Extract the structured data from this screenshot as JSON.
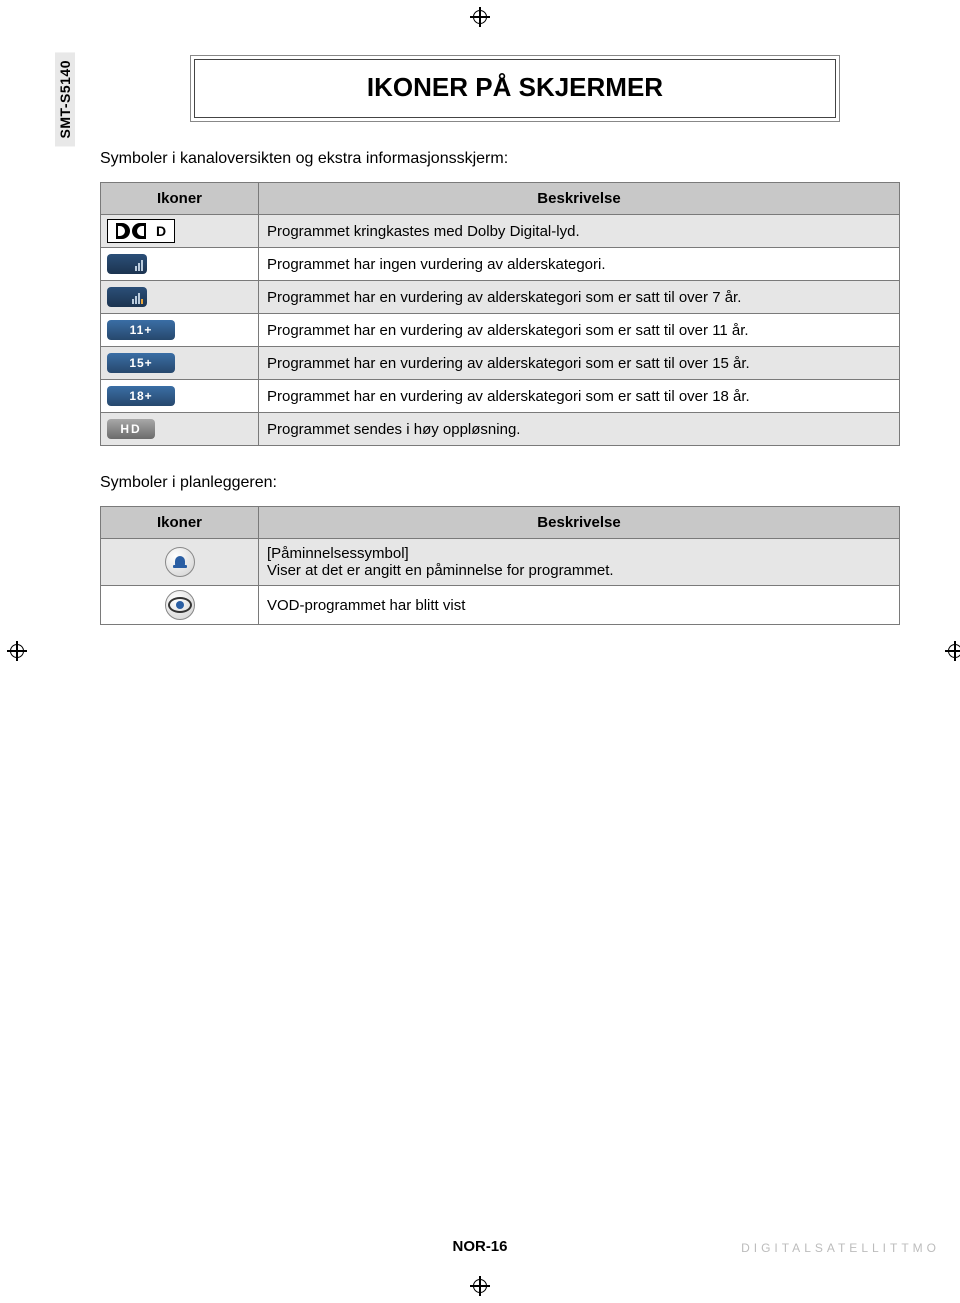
{
  "side_tab": "SMT-S5140",
  "title": "IKONER PÅ SKJERMER",
  "intro1": "Symboler i kanaloversikten og ekstra informasjonsskjerm:",
  "intro2": "Symboler i planleggeren:",
  "table1": {
    "h1": "Ikoner",
    "h2": "Beskrivelse",
    "rows": [
      {
        "icon": "dolby",
        "desc": "Programmet kringkastes med Dolby Digital-lyd."
      },
      {
        "icon": "norating",
        "desc": "Programmet har ingen vurdering av alderskategori."
      },
      {
        "icon": "age7",
        "desc": "Programmet har en vurdering av alderskategori som er satt til over 7 år."
      },
      {
        "icon": "11+",
        "label": "11+",
        "desc": "Programmet har en vurdering av alderskategori som er satt til over 11 år."
      },
      {
        "icon": "15+",
        "label": "15+",
        "desc": "Programmet har en vurdering av alderskategori som er satt til over 15 år."
      },
      {
        "icon": "18+",
        "label": "18+",
        "desc": "Programmet har en vurdering av alderskategori som er satt til over 18 år."
      },
      {
        "icon": "HD",
        "label": "HD",
        "desc": "Programmet sendes i høy oppløsning."
      }
    ]
  },
  "table2": {
    "h1": "Ikoner",
    "h2": "Beskrivelse",
    "rows": [
      {
        "icon": "bell",
        "title": "[Påminnelsessymbol]",
        "desc": "Viser at det er angitt en påminnelse for programmet."
      },
      {
        "icon": "eye",
        "desc": "VOD-programmet har blitt vist"
      }
    ]
  },
  "footer_center": "NOR-16",
  "footer_right": "DIGITALSATELLITTMO"
}
